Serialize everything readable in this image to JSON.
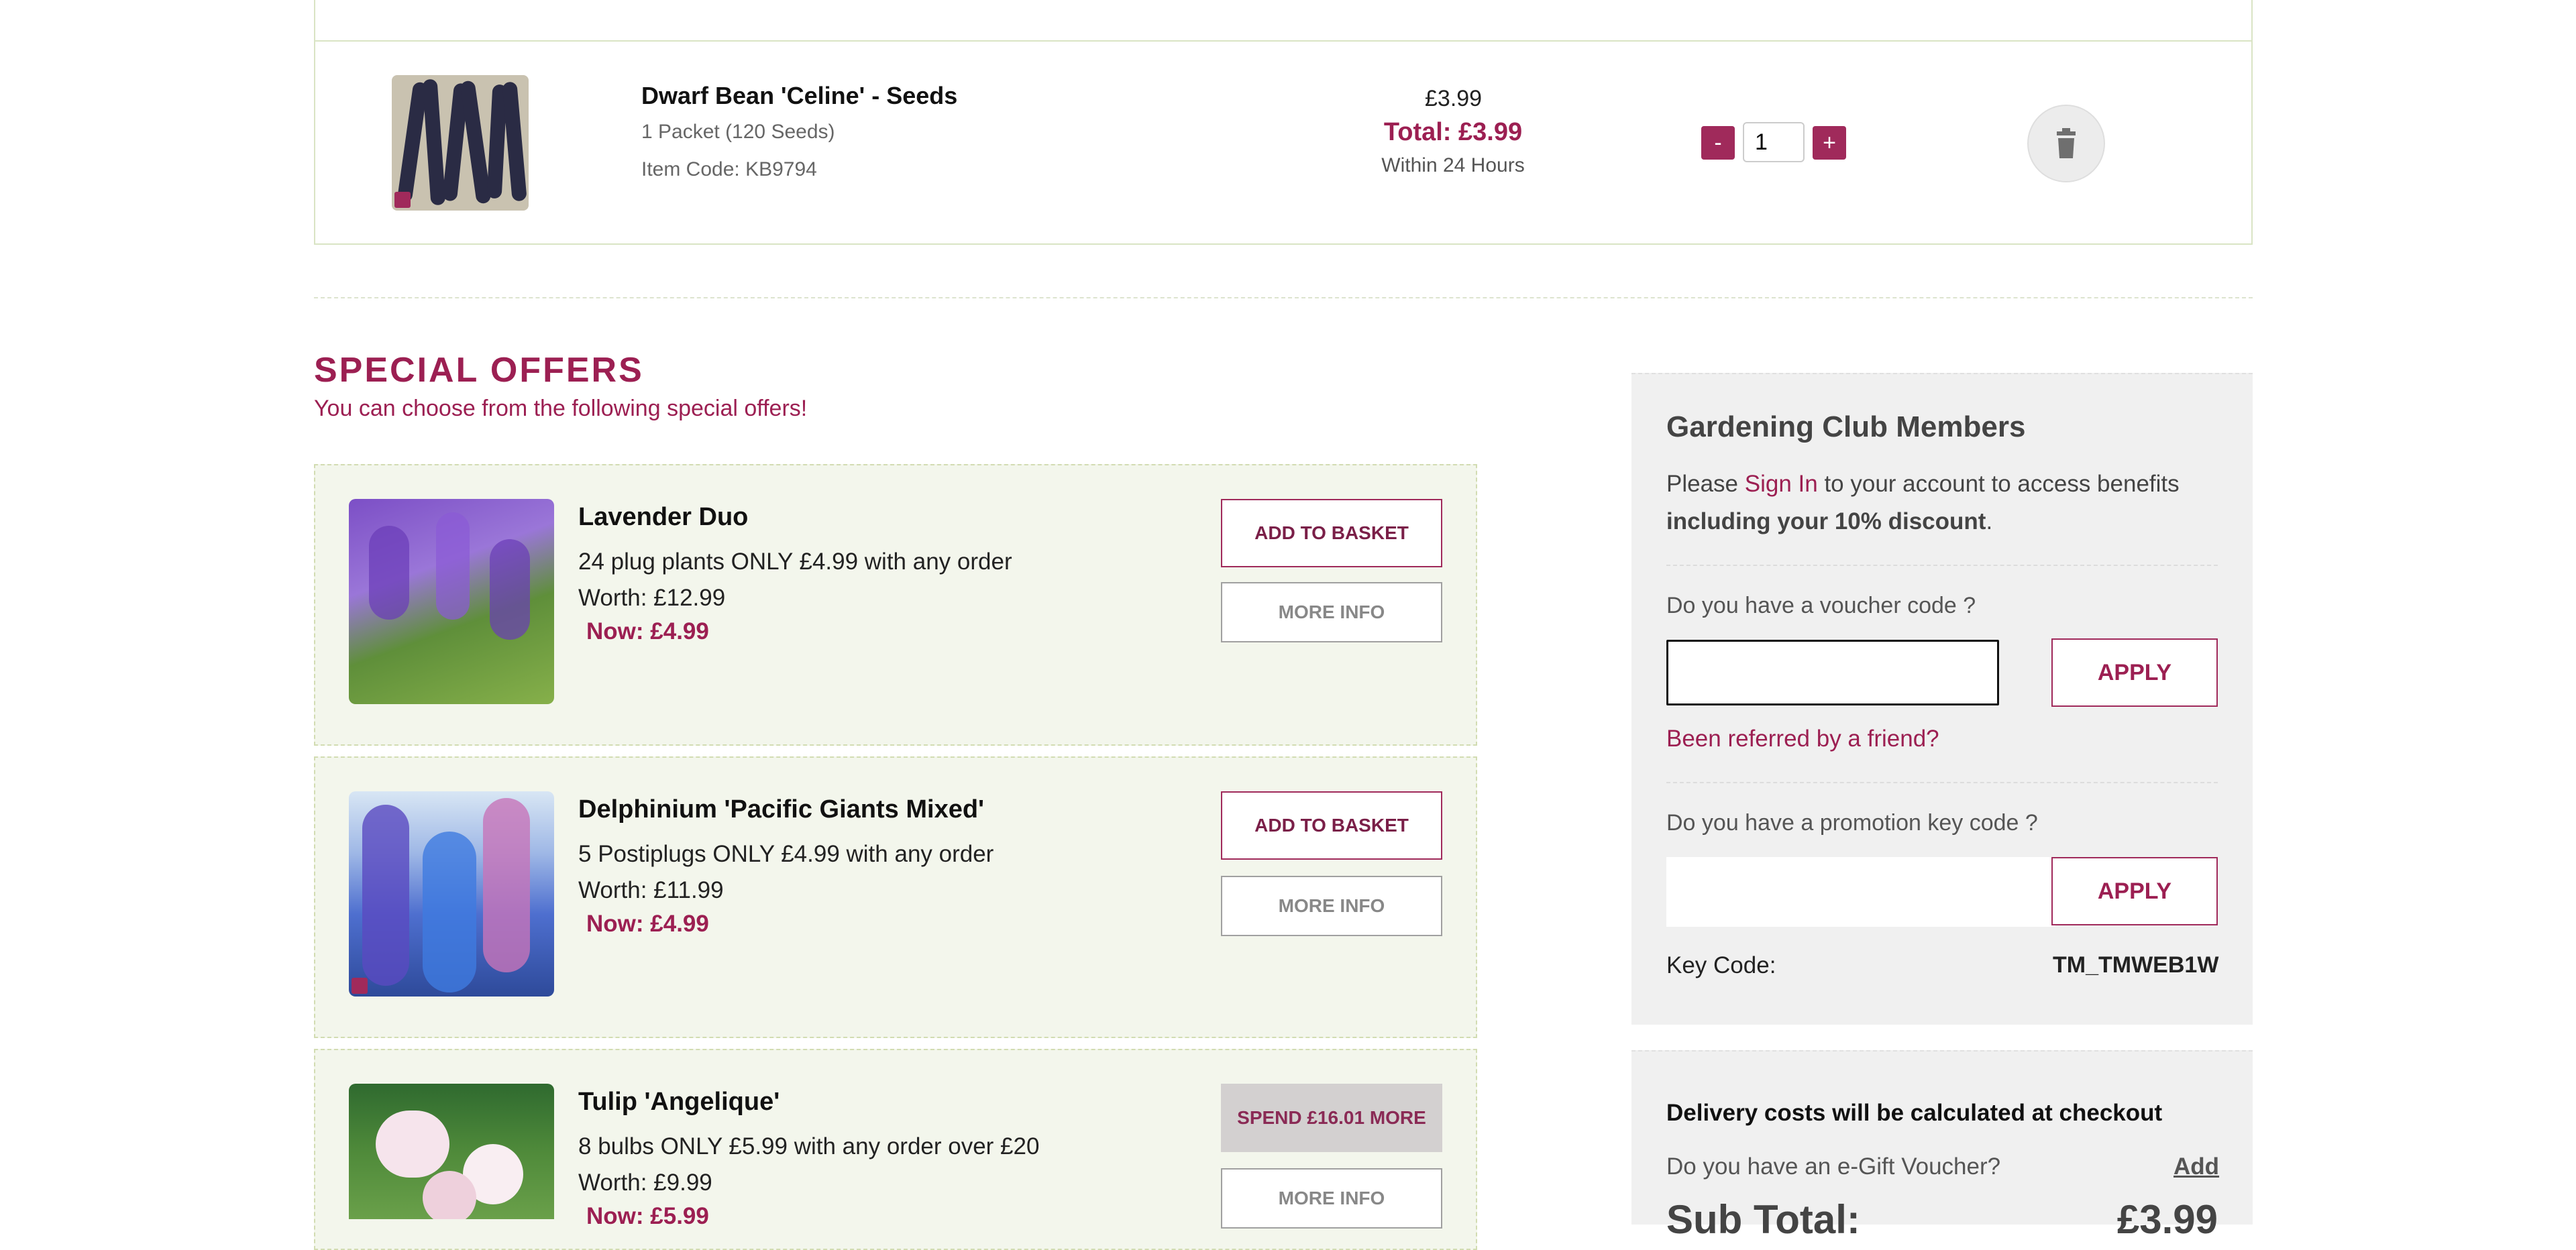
{
  "basket": {
    "item": {
      "name": "Dwarf Bean 'Celine' - Seeds",
      "pack": "1 Packet (120 Seeds)",
      "code": "Item Code: KB9794",
      "price": "£3.99",
      "total": "Total: £3.99",
      "dispatch": "Within 24 Hours",
      "quantity": "1",
      "minus_label": "-",
      "plus_label": "+"
    }
  },
  "special_offers": {
    "title": "SPECIAL OFFERS",
    "subtitle": "You can choose from the following special offers!",
    "offers": [
      {
        "name": "Lavender Duo",
        "desc": "24 plug plants ONLY £4.99 with any order",
        "worth": "Worth: £12.99",
        "now": "Now: £4.99",
        "primary_button": "ADD TO BASKET",
        "more_button": "MORE INFO"
      },
      {
        "name": "Delphinium 'Pacific Giants Mixed'",
        "desc": "5 Postiplugs ONLY £4.99 with any order",
        "worth": "Worth: £11.99",
        "now": "Now: £4.99",
        "primary_button": "ADD TO BASKET",
        "more_button": "MORE INFO"
      },
      {
        "name": "Tulip 'Angelique'",
        "desc": "8 bulbs ONLY £5.99 with any order over £20",
        "worth": "Worth: £9.99",
        "now": "Now: £5.99",
        "primary_button": "SPEND £16.01 MORE",
        "more_button": "MORE INFO"
      }
    ]
  },
  "club": {
    "title": "Gardening Club Members",
    "text_before": "Please ",
    "sign_in": "Sign In",
    "text_after": " to your account to access benefits",
    "text_bold": "including your 10% discount",
    "text_end": ".",
    "voucher_label": "Do you have a voucher code ?",
    "voucher_apply": "APPLY",
    "referred": "Been referred by a friend?",
    "promo_label": "Do you have a promotion key code ?",
    "promo_apply": "APPLY",
    "keycode_label": "Key Code:",
    "keycode_value": "TM_TMWEB1W"
  },
  "summary": {
    "delivery": "Delivery costs will be calculated at checkout",
    "egift": "Do you have an e-Gift Voucher?",
    "egift_add": "Add",
    "subtotal_label": "Sub Total:",
    "subtotal_value": "£3.99"
  },
  "colors": {
    "accent": "#9c1f52",
    "offer_bg": "#f3f6ec",
    "panel_bg": "#f0f0f0"
  }
}
